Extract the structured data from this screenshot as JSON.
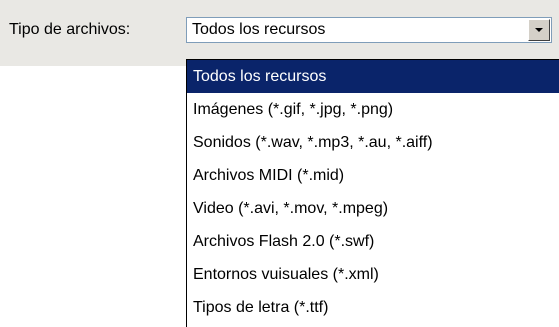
{
  "form": {
    "label": "Tipo de archivos:"
  },
  "combo": {
    "selected": "Todos los recursos",
    "arrow_icon": "chevron-down-icon"
  },
  "dropdown": {
    "selected_index": 0,
    "options": [
      "Todos los recursos",
      "Imágenes (*.gif, *.jpg, *.png)",
      "Sonidos (*.wav, *.mp3, *.au, *.aiff)",
      "Archivos MIDI (*.mid)",
      "Video (*.avi, *.mov, *.mpeg)",
      "Archivos Flash 2.0 (*.swf)",
      "Entornos vuisuales (*.xml)",
      "Tipos de letra (*.ttf)"
    ]
  },
  "colors": {
    "highlight": "#0a246a",
    "highlight_text": "#ffffff",
    "panel": "#e9e8e4",
    "combo_border": "#7f9db9"
  }
}
